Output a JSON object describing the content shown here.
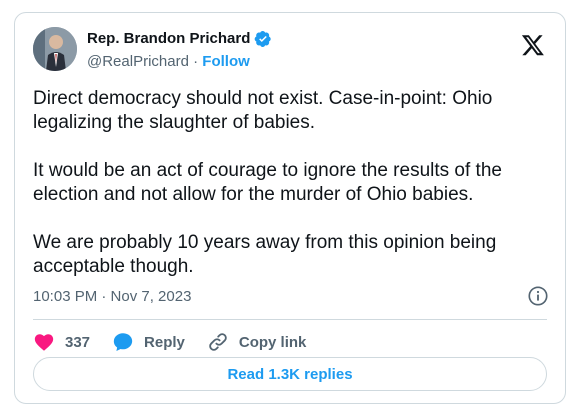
{
  "tweet": {
    "author_name": "Rep. Brandon Prichard",
    "handle": "@RealPrichard",
    "separator": "·",
    "follow_label": "Follow",
    "body": "Direct democracy should not exist. Case-in-point: Ohio legalizing the slaughter of babies.\n\nIt would be an act of courage to ignore the results of the election and not allow for the murder of Ohio babies.\n\nWe are probably 10 years away from this opinion being acceptable though.",
    "timestamp": "10:03 PM · Nov 7, 2023"
  },
  "actions": {
    "like_count": "337",
    "reply_label": "Reply",
    "copy_link_label": "Copy link"
  },
  "replies_button_label": "Read 1.3K replies",
  "icons": {
    "verified": "verified-badge-icon",
    "x_logo": "x-logo-icon",
    "info": "info-icon",
    "heart": "heart-icon",
    "reply": "reply-bubble-icon",
    "link": "link-icon"
  },
  "colors": {
    "accent": "#1d9bf0",
    "like": "#f91880",
    "text": "#0f1419",
    "muted": "#536471",
    "border": "#cfd9de"
  }
}
